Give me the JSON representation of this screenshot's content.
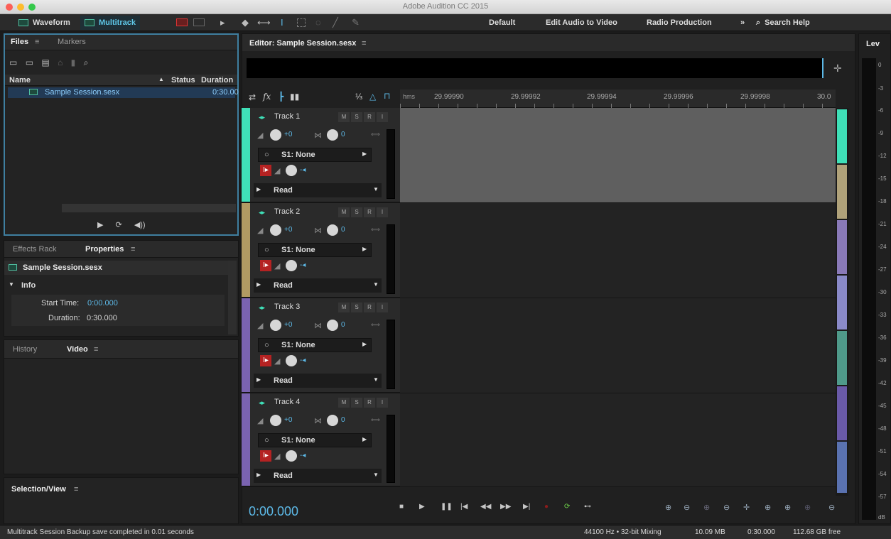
{
  "window": {
    "title": "Adobe Audition CC 2015"
  },
  "toolbar": {
    "waveform_label": "Waveform",
    "multitrack_label": "Multitrack",
    "workspaces": [
      "Default",
      "Edit Audio to Video",
      "Radio Production"
    ],
    "more_label": "»",
    "search_label": "Search Help"
  },
  "files_panel": {
    "tabs": [
      "Files",
      "Markers"
    ],
    "columns": {
      "name": "Name",
      "status": "Status",
      "duration": "Duration"
    },
    "rows": [
      {
        "name": "Sample Session.sesx",
        "duration": "0:30.00"
      }
    ]
  },
  "properties_panel": {
    "tabs": [
      "Effects Rack",
      "Properties"
    ],
    "file_name": "Sample Session.sesx",
    "section": "Info",
    "start_time_label": "Start Time:",
    "start_time_value": "0:00.000",
    "duration_label": "Duration:",
    "duration_value": "0:30.000"
  },
  "history_panel": {
    "tabs": [
      "History",
      "Video"
    ]
  },
  "selection_panel": {
    "title": "Selection/View"
  },
  "editor": {
    "title": "Editor: Sample Session.sesx",
    "ruler_unit": "hms",
    "ruler_ticks": [
      "29.99990",
      "29.99992",
      "29.99994",
      "29.99996",
      "29.99998",
      "30.0"
    ],
    "time_display": "0:00.000"
  },
  "tracks": [
    {
      "name": "Track 1",
      "volume": "+0",
      "pan": "0",
      "send": "S1: None",
      "automation": "Read",
      "color": "#3fe0b8",
      "m": "M",
      "s": "S",
      "r": "R",
      "i": "I"
    },
    {
      "name": "Track 2",
      "volume": "+0",
      "pan": "0",
      "send": "S1: None",
      "automation": "Read",
      "color": "#b09a63",
      "m": "M",
      "s": "S",
      "r": "R",
      "i": "I"
    },
    {
      "name": "Track 3",
      "volume": "+0",
      "pan": "0",
      "send": "S1: None",
      "automation": "Read",
      "color": "#7a63b0",
      "m": "M",
      "s": "S",
      "r": "R",
      "i": "I"
    },
    {
      "name": "Track 4",
      "volume": "+0",
      "pan": "0",
      "send": "S1: None",
      "automation": "Read",
      "color": "#7a63b0",
      "m": "M",
      "s": "S",
      "r": "R",
      "i": "I"
    }
  ],
  "levels": {
    "title": "Lev",
    "db_scale": [
      "0",
      "-3",
      "-6",
      "-9",
      "-12",
      "-15",
      "-18",
      "-21",
      "-24",
      "-27",
      "-30",
      "-33",
      "-36",
      "-39",
      "-42",
      "-45",
      "-48",
      "-51",
      "-54",
      "-57",
      "dB"
    ]
  },
  "status": {
    "message": "Multitrack Session Backup save completed in 0.01 seconds",
    "sample_rate": "44100 Hz • 32-bit Mixing",
    "size": "10.09 MB",
    "duration": "0:30.000",
    "free_space": "112.68 GB free"
  },
  "colors": {
    "accent": "#5cb8e6",
    "track_teal": "#3fe0b8",
    "track_tan": "#b09a63",
    "track_purple": "#7a63b0"
  }
}
